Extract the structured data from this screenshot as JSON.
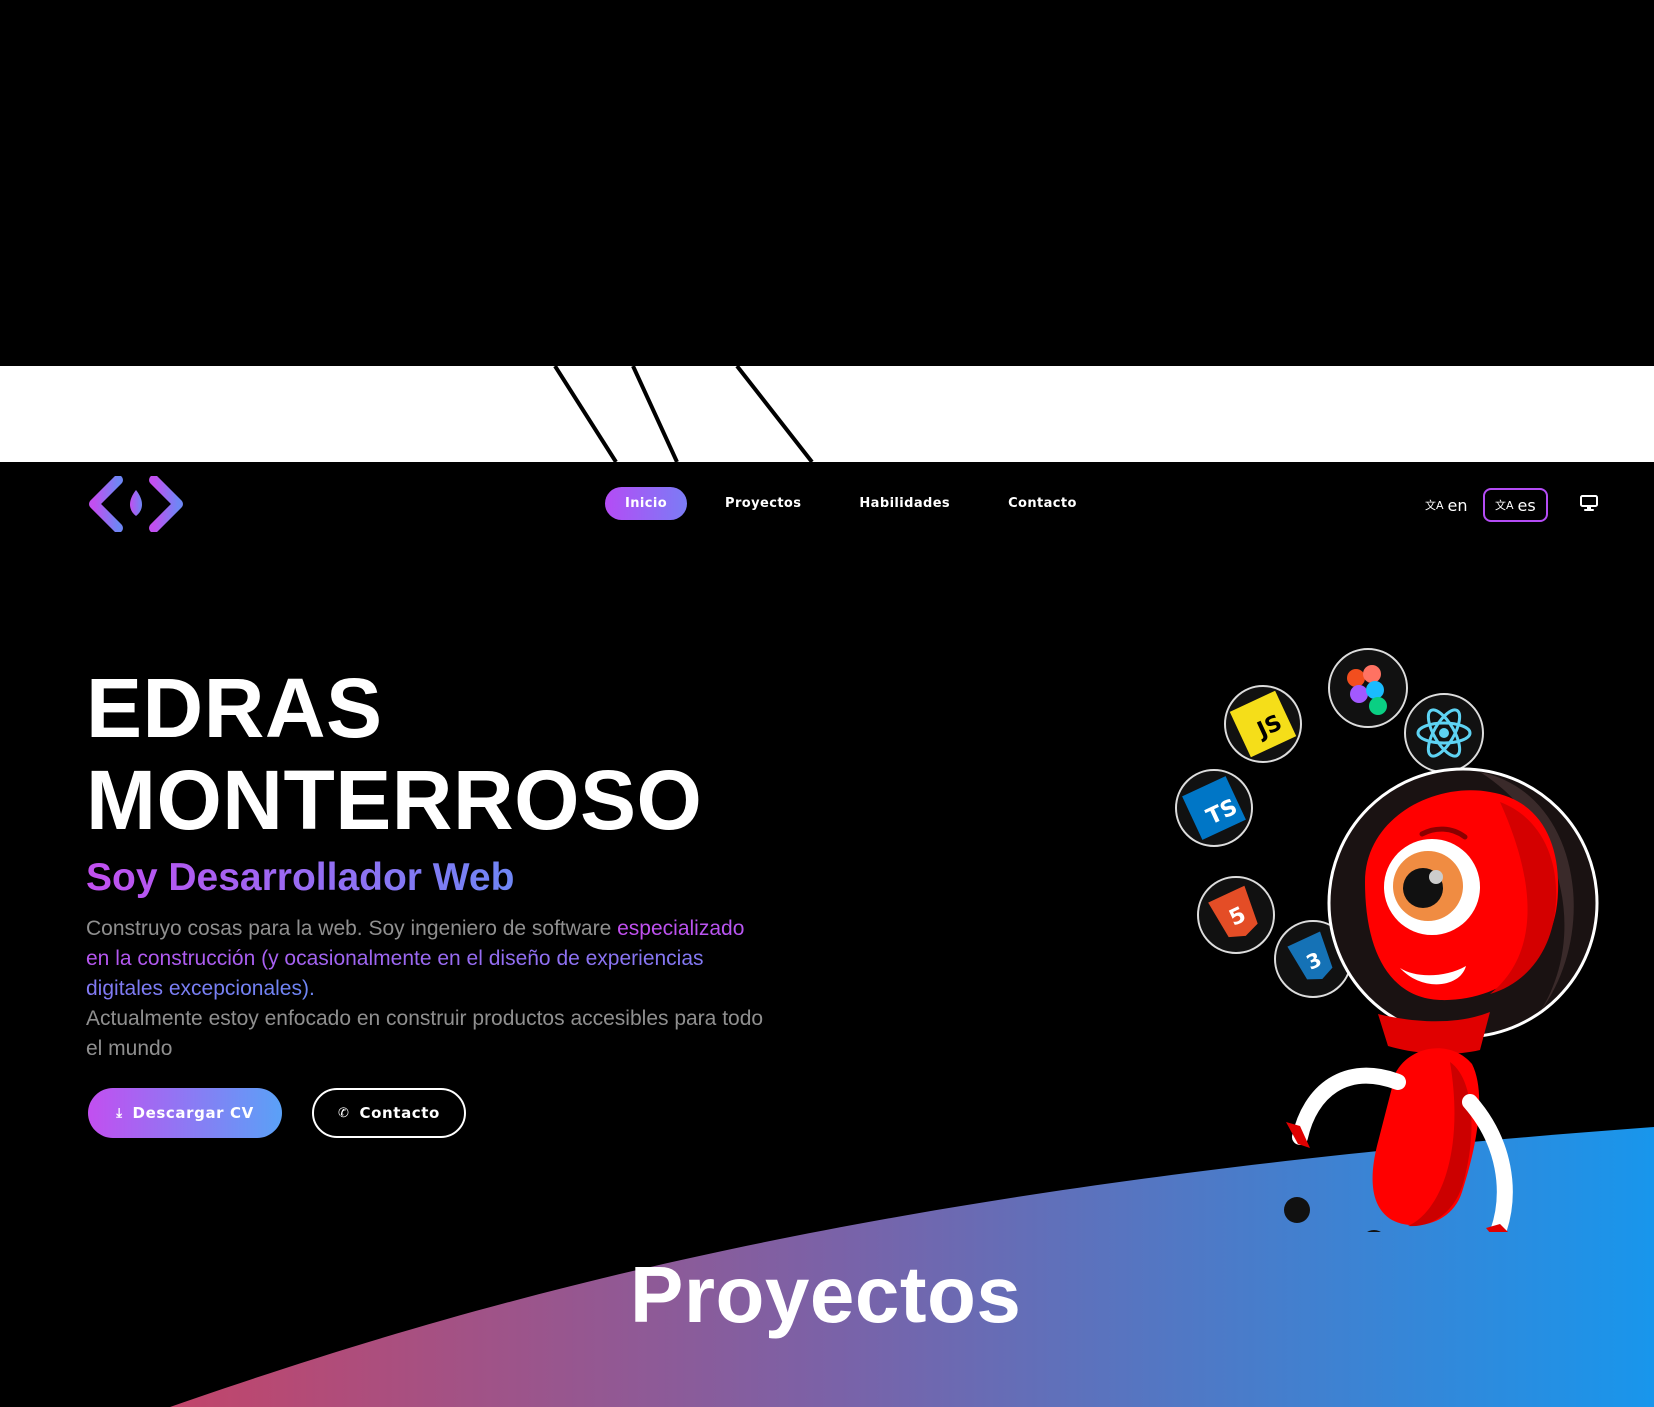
{
  "nav": {
    "items": [
      {
        "label": "Inicio",
        "active": true
      },
      {
        "label": "Proyectos",
        "active": false
      },
      {
        "label": "Habilidades",
        "active": false
      },
      {
        "label": "Contacto",
        "active": false
      }
    ]
  },
  "lang": {
    "en": "en",
    "es": "es",
    "active": "es"
  },
  "hero": {
    "name_line1": "EDRAS",
    "name_line2": "MONTERROSO",
    "subtitle": "Soy Desarrollador Web",
    "desc_part1": "Construyo cosas para la web. Soy ingeniero de software ",
    "desc_highlight": "especializado en la construcción (y ocasionalmente en el diseño de experiencias digitales excepcionales).",
    "desc_part2": "Actualmente estoy enfocado en construir productos accesibles para todo el mundo"
  },
  "buttons": {
    "download": "Descargar CV",
    "contact": "Contacto"
  },
  "sections": {
    "projects_title": "Proyectos"
  },
  "icons": {
    "tech": [
      "figma-icon",
      "javascript-icon",
      "react-icon",
      "typescript-icon",
      "html5-icon",
      "css3-icon"
    ]
  },
  "colors": {
    "accent_purple": "#b44cf5",
    "accent_blue": "#6f86f5",
    "wave_left": "#c2456a",
    "wave_right": "#1896ec",
    "robot_red": "#ff0000"
  }
}
